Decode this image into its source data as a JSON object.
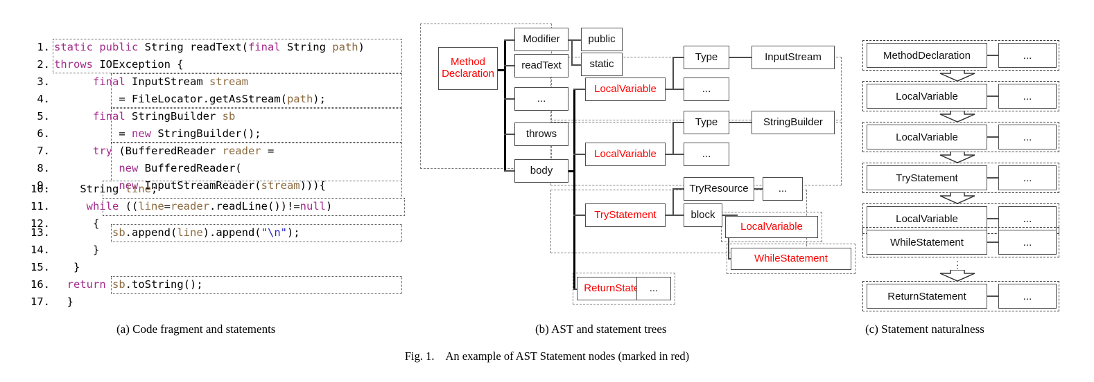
{
  "figure": {
    "label": "Fig. 1.",
    "caption": "An example of AST Statement nodes (marked in red)",
    "colors": {
      "statement_red": "#ff0000",
      "keyword": "#a32a8c",
      "identifier": "#8b6a3f",
      "string": "#2222cc"
    }
  },
  "panel_a": {
    "caption": "(a) Code fragment and statements",
    "lines": [
      {
        "n": "1.",
        "code": "static public String readText(final String path)"
      },
      {
        "n": "2.",
        "code": "throws IOException {"
      },
      {
        "n": "3.",
        "code": "      final InputStream stream"
      },
      {
        "n": "4.",
        "code": "          = FileLocator.getAsStream(path);"
      },
      {
        "n": "5.",
        "code": "      final StringBuilder sb"
      },
      {
        "n": "6.",
        "code": "          = new StringBuilder();"
      },
      {
        "n": "7.",
        "code": "      try (BufferedReader reader ="
      },
      {
        "n": "8.",
        "code": "          new BufferedReader("
      },
      {
        "n": "9.",
        "code": "          new InputStreamReader(stream))){"
      },
      {
        "n": "10.",
        "code": "    String line;"
      },
      {
        "n": "11.",
        "code": "     while ((line=reader.readLine())!=null)"
      },
      {
        "n": "12.",
        "code": "      {"
      },
      {
        "n": "13.",
        "code": "         sb.append(line).append(\"\\n\");"
      },
      {
        "n": "14.",
        "code": "      }"
      },
      {
        "n": "15.",
        "code": "   }"
      },
      {
        "n": "16.",
        "code": "  return sb.toString();"
      },
      {
        "n": "17.",
        "code": "  }"
      }
    ],
    "statement_boxes": [
      {
        "name": "method-declaration-statement",
        "lines": "1-2"
      },
      {
        "name": "local-variable-stream-statement",
        "lines": "3-4"
      },
      {
        "name": "local-variable-sb-statement",
        "lines": "5-6"
      },
      {
        "name": "try-statement",
        "lines": "7-9"
      },
      {
        "name": "local-variable-line-statement",
        "lines": "10"
      },
      {
        "name": "while-statement",
        "lines": "11"
      },
      {
        "name": "append-expression-statement",
        "lines": "13"
      },
      {
        "name": "return-statement",
        "lines": "16"
      }
    ]
  },
  "panel_b": {
    "caption": "(b) AST and statement trees",
    "nodes": {
      "method_declaration": "Method\nDeclaration",
      "method_declaration_l1": "Method",
      "method_declaration_l2": "Declaration",
      "modifier": "Modifier",
      "public": "public",
      "static": "static",
      "read_text": "readText",
      "ellipsis": "...",
      "throws": "throws",
      "body": "body",
      "local_variable_1": "LocalVariable",
      "type_1": "Type",
      "input_stream": "InputStream",
      "ellipsis_1": "...",
      "local_variable_2": "LocalVariable",
      "type_2": "Type",
      "string_builder": "StringBuilder",
      "ellipsis_2": "...",
      "try_statement": "TryStatement",
      "try_resource": "TryResource",
      "ellipsis_3": "...",
      "block": "block",
      "local_variable_3": "LocalVariable",
      "while_statement": "WhileStatement",
      "return_statement": "ReturnStatement",
      "ellipsis_4": "..."
    }
  },
  "panel_c": {
    "caption": "(c) Statement naturalness",
    "ellipsis_label": "...",
    "vertical_dots": "⋮",
    "rows": [
      {
        "label": "MethodDeclaration",
        "detail": "...",
        "arrow_after": "block-arrow"
      },
      {
        "label": "LocalVariable",
        "detail": "...",
        "arrow_after": "block-arrow"
      },
      {
        "label": "LocalVariable",
        "detail": "...",
        "arrow_after": "block-arrow"
      },
      {
        "label": "TryStatement",
        "detail": "...",
        "arrow_after": "block-arrow"
      },
      {
        "label": "LocalVariable",
        "detail": "...",
        "arrow_after": "block-arrow"
      },
      {
        "label": "WhileStatement",
        "detail": "...",
        "arrow_after": "dots-then-block-arrow"
      },
      {
        "label": "ReturnStatement",
        "detail": "...",
        "arrow_after": "none"
      }
    ]
  }
}
